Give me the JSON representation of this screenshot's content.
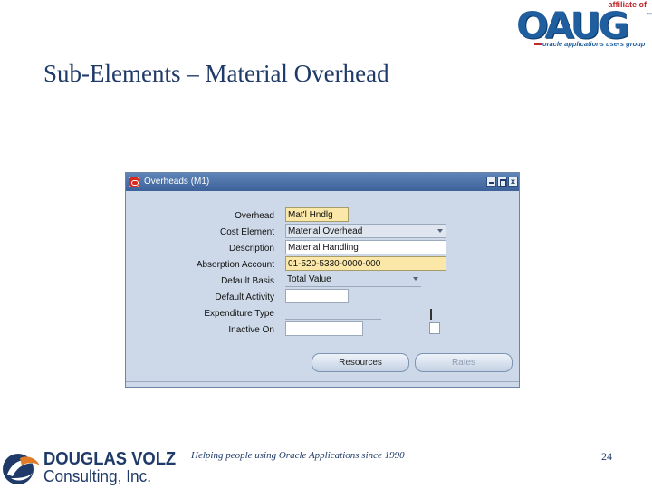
{
  "logo": {
    "affiliate_text": "affiliate of",
    "name": "OAUG",
    "trademark": "™",
    "tagline": "oracle applications users group"
  },
  "slide": {
    "title": "Sub-Elements – Material Overhead",
    "footer_tagline": "Helping people using Oracle Applications since 1990",
    "page_number": "24"
  },
  "company_logo": {
    "line1": "DOUGLAS VOLZ",
    "line2": "Consulting, Inc."
  },
  "window": {
    "title": "Overheads (M1)",
    "close_glyph": "x"
  },
  "form": {
    "fields": [
      {
        "label": "Overhead",
        "value": "Mat'l Hndlg"
      },
      {
        "label": "Cost Element",
        "value": "Material Overhead"
      },
      {
        "label": "Description",
        "value": "Material Handling"
      },
      {
        "label": "Absorption Account",
        "value": "01-520-5330-0000-000"
      },
      {
        "label": "Default Basis",
        "value": "Total Value"
      },
      {
        "label": "Default Activity",
        "value": ""
      },
      {
        "label": "Expenditure Type",
        "value": ""
      },
      {
        "label": "Inactive On",
        "value": ""
      }
    ],
    "buttons": {
      "resources": "Resources",
      "rates": "Rates"
    }
  },
  "colors": {
    "title_text": "#1f3a68",
    "window_background": "#cdd9e8",
    "titlebar": "#3d629a",
    "required_field": "#fbe7a7",
    "oaug_blue": "#1f5f9f",
    "oaug_red": "#c0282d",
    "oracle_icon": "#d52b1e"
  }
}
